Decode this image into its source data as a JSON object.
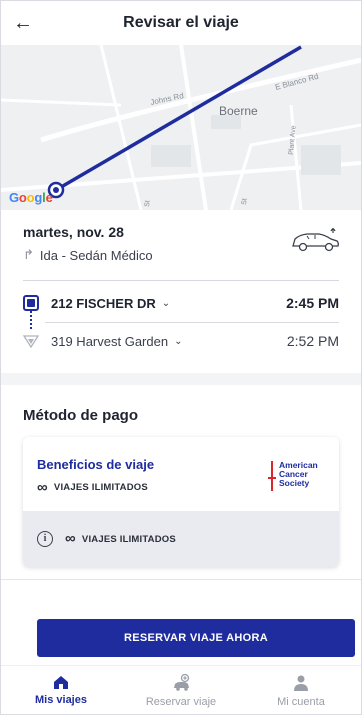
{
  "header": {
    "title": "Revisar el viaje",
    "back_icon": "arrow-left-icon"
  },
  "map": {
    "streets": [
      "Johns Rd",
      "E Blanco Rd",
      "Plant Ave",
      "St",
      "St"
    ],
    "city": "Boerne",
    "route_color": "#1f2c9e"
  },
  "trip": {
    "date": "martes, nov. 28",
    "type": "Ida - Sedán Médico"
  },
  "stops": [
    {
      "label": "212 FISCHER DR",
      "time": "2:45 PM"
    },
    {
      "label": "319 Harvest Garden",
      "time": "2:52 PM"
    }
  ],
  "payment": {
    "title": "Método de pago",
    "benefit_title": "Beneficios de viaje",
    "unlimited": "VIAJES ILIMITADOS",
    "infinity_symbol": "∞",
    "info_unlimited": "VIAJES ILIMITADOS",
    "logo_text": [
      "American",
      "Cancer",
      "Society"
    ]
  },
  "cta": {
    "label": "RESERVAR VIAJE AHORA"
  },
  "nav": [
    {
      "label": "Mis viajes",
      "icon": "home-icon",
      "active": true
    },
    {
      "label": "Reservar viaje",
      "icon": "car-plus-icon",
      "active": false
    },
    {
      "label": "Mi cuenta",
      "icon": "user-icon",
      "active": false
    }
  ],
  "colors": {
    "primary": "#1f2c9e",
    "text": "#1f2430",
    "muted": "#9a9ea8"
  }
}
